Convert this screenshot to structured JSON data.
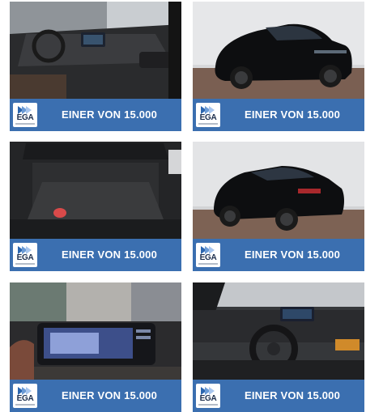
{
  "gallery": {
    "items": [
      {
        "photo": "car-interior-dashboard",
        "logo_text": "EGA",
        "banner_text": "EINER VON 15.000"
      },
      {
        "photo": "car-exterior-front",
        "logo_text": "EGA",
        "banner_text": "EINER VON 15.000"
      },
      {
        "photo": "car-trunk",
        "logo_text": "EGA",
        "banner_text": "EINER VON 15.000"
      },
      {
        "photo": "car-exterior-rear",
        "logo_text": "EGA",
        "banner_text": "EINER VON 15.000"
      },
      {
        "photo": "car-infotainment-screen",
        "logo_text": "EGA",
        "banner_text": "EINER VON 15.000"
      },
      {
        "photo": "car-interior-steering-wheel",
        "logo_text": "EGA",
        "banner_text": "EINER VON 15.000"
      }
    ]
  },
  "colors": {
    "banner": "#3b6fb0",
    "banner_text": "#ffffff",
    "logo_bg": "#ffffff"
  }
}
